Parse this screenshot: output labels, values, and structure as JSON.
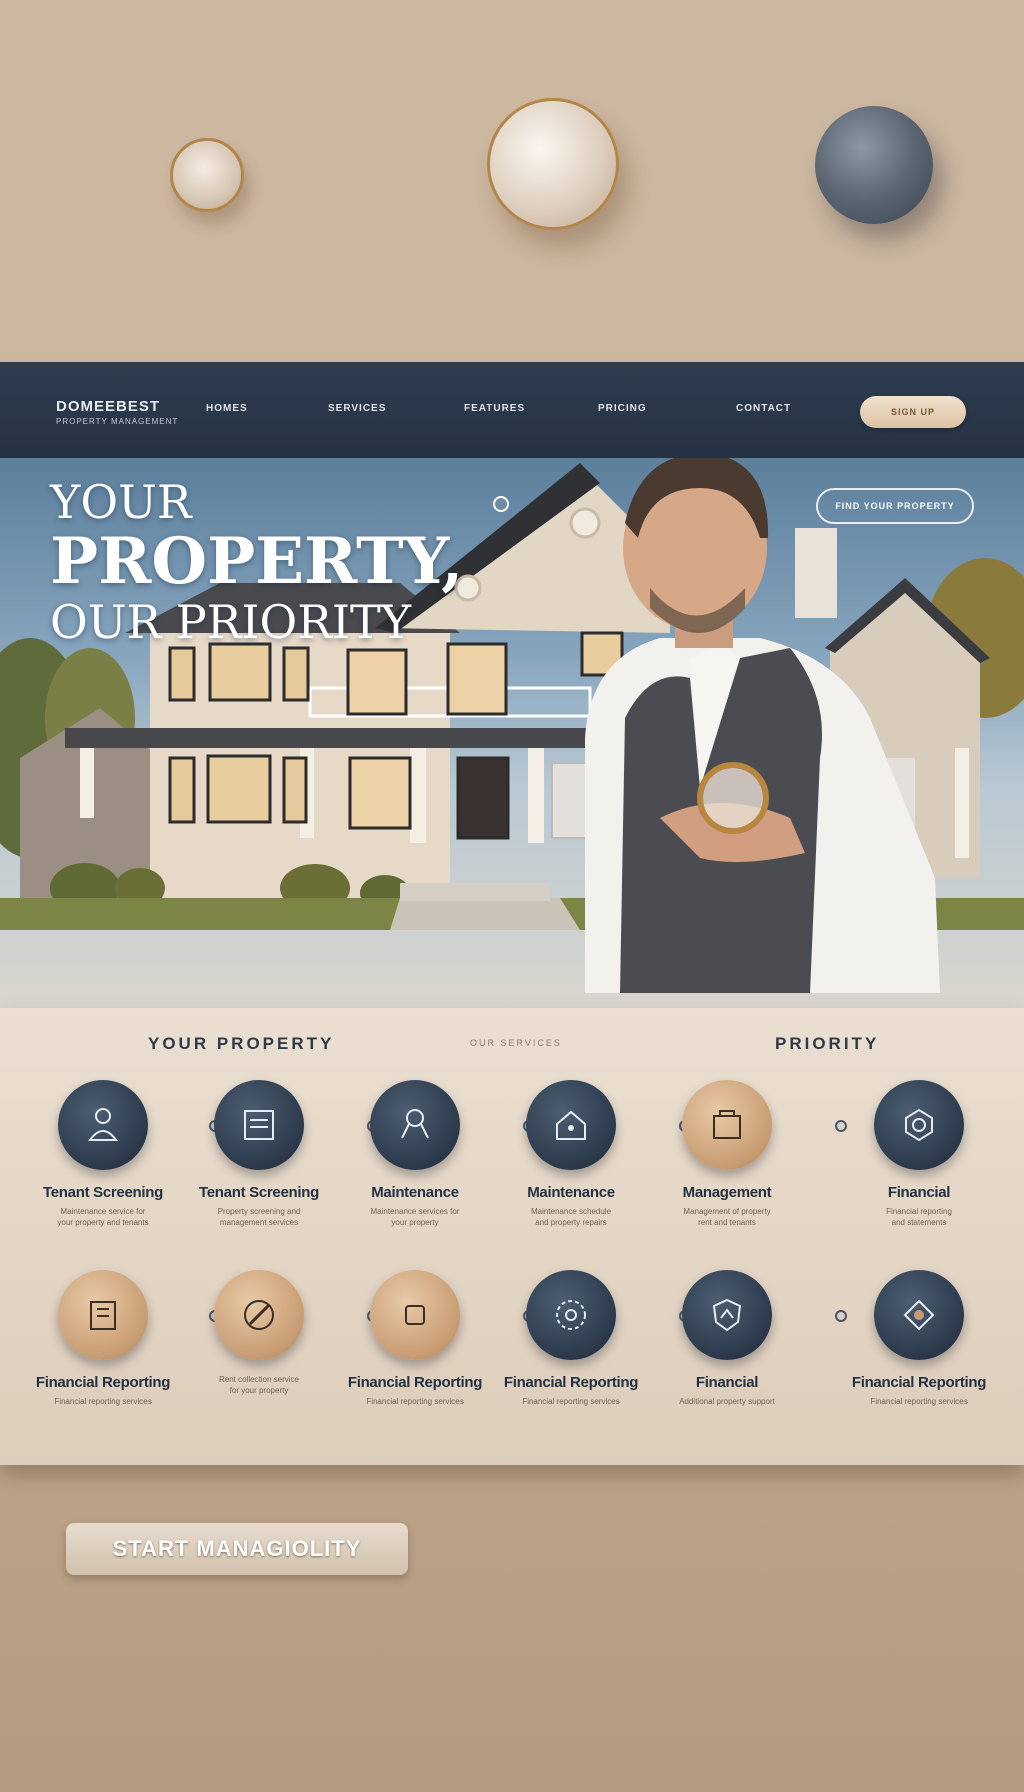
{
  "header": {
    "logo_main": "DOMEEBEST",
    "logo_sub": "PROPERTY MANAGEMENT",
    "nav": [
      "HOMES",
      "SERVICES",
      "FEATURES",
      "PRICING",
      "CONTACT"
    ],
    "cta_label": "SIGN UP"
  },
  "hero": {
    "title_line1": "YOUR",
    "title_line2": "PROPERTY,",
    "title_line3": "OUR PRIORITY",
    "pill_label": "FIND YOUR PROPERTY"
  },
  "services": {
    "heading_left": "YOUR PROPERTY",
    "heading_mid": "OUR SERVICES",
    "heading_right": "PRIORITY",
    "items": [
      {
        "title": "Tenant Screening",
        "desc": "Maintenance service for",
        "desc2": "your property and tenants",
        "icon": "person-icon",
        "tone": "dark"
      },
      {
        "title": "Tenant Screening",
        "desc": "Property screening and",
        "desc2": "management services",
        "icon": "document-icon",
        "tone": "dark"
      },
      {
        "title": "Maintenance",
        "desc": "Maintenance services for",
        "desc2": "your property",
        "icon": "wrench-icon",
        "tone": "dark"
      },
      {
        "title": "Maintenance",
        "desc": "Maintenance schedule",
        "desc2": "and property repairs",
        "icon": "home-icon",
        "tone": "dark"
      },
      {
        "title": "Management",
        "desc": "Management of property",
        "desc2": "rent and tenants",
        "icon": "folder-icon",
        "tone": "tan"
      },
      {
        "title": "Financial",
        "desc": "Financial reporting",
        "desc2": "and statements",
        "icon": "gear-icon",
        "tone": "dark"
      },
      {
        "title": "Financial Reporting",
        "desc": "Financial reporting services",
        "desc2": "",
        "icon": "building-icon",
        "tone": "tan"
      },
      {
        "title": "",
        "desc": "Rent collection service",
        "desc2": "for your property",
        "icon": "pen-icon",
        "tone": "tan"
      },
      {
        "title": "Financial Reporting",
        "desc": "Financial reporting services",
        "desc2": "",
        "icon": "square-icon",
        "tone": "tan"
      },
      {
        "title": "Financial Reporting",
        "desc": "Financial reporting services",
        "desc2": "",
        "icon": "ring-icon",
        "tone": "dark"
      },
      {
        "title": "Financial",
        "desc": "Additional property support",
        "desc2": "",
        "icon": "shield-icon",
        "tone": "dark"
      },
      {
        "title": "Financial Reporting",
        "desc": "Financial reporting services",
        "desc2": "",
        "icon": "diamond-icon",
        "tone": "dark"
      }
    ]
  },
  "cta": {
    "label": "START MANAGIOLITY"
  }
}
